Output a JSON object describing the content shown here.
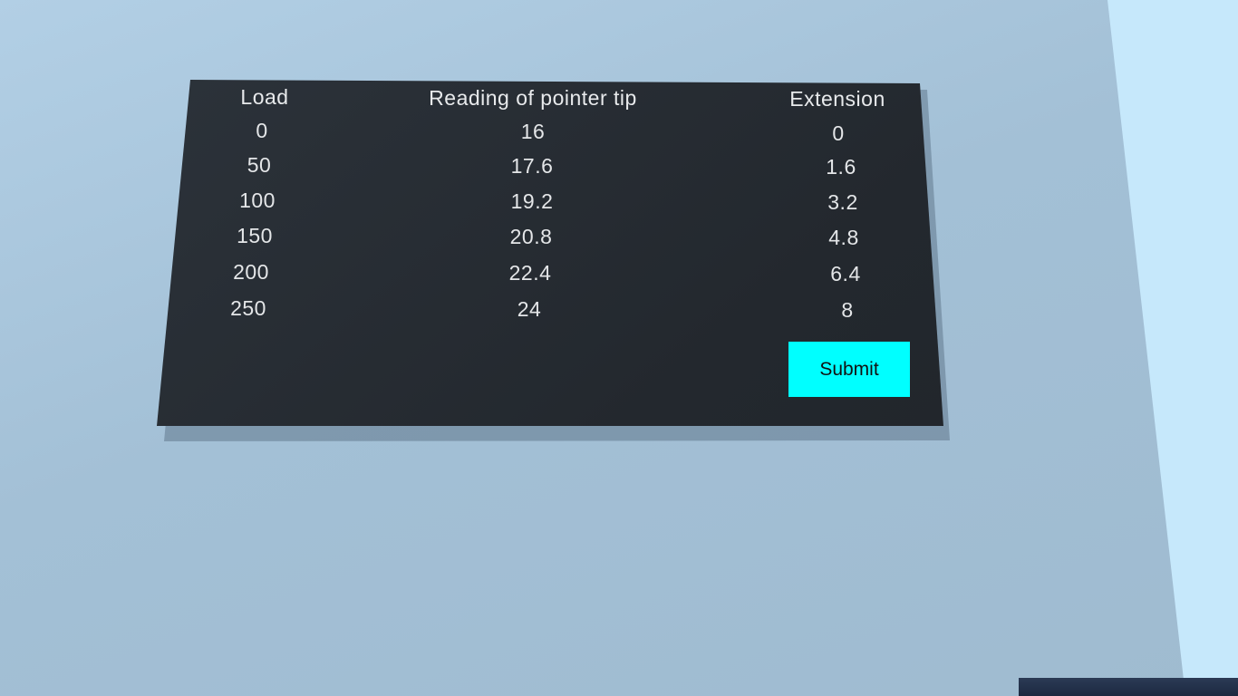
{
  "table": {
    "headers": [
      "Load",
      "Reading of pointer tip",
      "Extension"
    ],
    "rows": [
      [
        "0",
        "16",
        "0"
      ],
      [
        "50",
        "17.6",
        "1.6"
      ],
      [
        "100",
        "19.2",
        "3.2"
      ],
      [
        "150",
        "20.8",
        "4.8"
      ],
      [
        "200",
        "22.4",
        "6.4"
      ],
      [
        "250",
        "24",
        "8"
      ]
    ]
  },
  "submit_label": "Submit",
  "colors": {
    "board": "#262b31",
    "submit_button": "#00ffff",
    "wall": "#a3c0d6"
  }
}
